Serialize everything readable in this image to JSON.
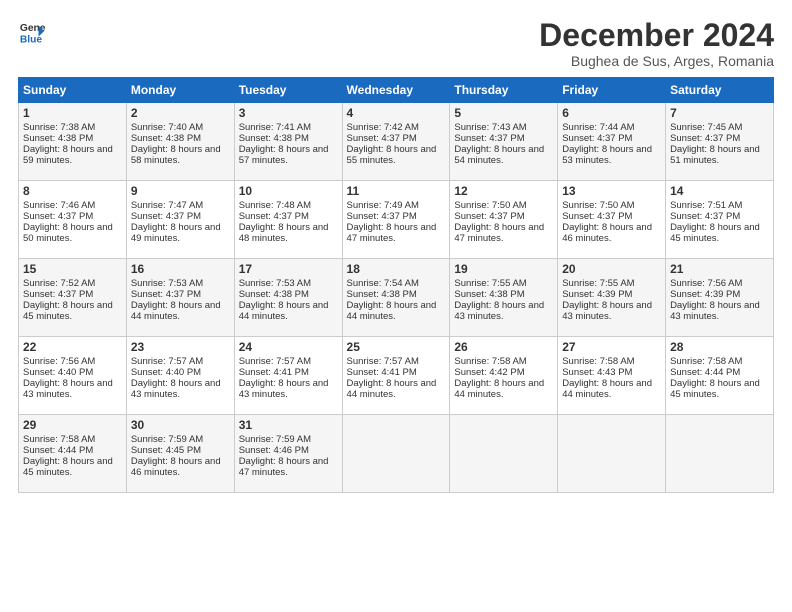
{
  "header": {
    "logo_line1": "General",
    "logo_line2": "Blue",
    "month_title": "December 2024",
    "location": "Bughea de Sus, Arges, Romania"
  },
  "days_of_week": [
    "Sunday",
    "Monday",
    "Tuesday",
    "Wednesday",
    "Thursday",
    "Friday",
    "Saturday"
  ],
  "weeks": [
    [
      {
        "day": "1",
        "sunrise": "Sunrise: 7:38 AM",
        "sunset": "Sunset: 4:38 PM",
        "daylight": "Daylight: 8 hours and 59 minutes."
      },
      {
        "day": "2",
        "sunrise": "Sunrise: 7:40 AM",
        "sunset": "Sunset: 4:38 PM",
        "daylight": "Daylight: 8 hours and 58 minutes."
      },
      {
        "day": "3",
        "sunrise": "Sunrise: 7:41 AM",
        "sunset": "Sunset: 4:38 PM",
        "daylight": "Daylight: 8 hours and 57 minutes."
      },
      {
        "day": "4",
        "sunrise": "Sunrise: 7:42 AM",
        "sunset": "Sunset: 4:37 PM",
        "daylight": "Daylight: 8 hours and 55 minutes."
      },
      {
        "day": "5",
        "sunrise": "Sunrise: 7:43 AM",
        "sunset": "Sunset: 4:37 PM",
        "daylight": "Daylight: 8 hours and 54 minutes."
      },
      {
        "day": "6",
        "sunrise": "Sunrise: 7:44 AM",
        "sunset": "Sunset: 4:37 PM",
        "daylight": "Daylight: 8 hours and 53 minutes."
      },
      {
        "day": "7",
        "sunrise": "Sunrise: 7:45 AM",
        "sunset": "Sunset: 4:37 PM",
        "daylight": "Daylight: 8 hours and 51 minutes."
      }
    ],
    [
      {
        "day": "8",
        "sunrise": "Sunrise: 7:46 AM",
        "sunset": "Sunset: 4:37 PM",
        "daylight": "Daylight: 8 hours and 50 minutes."
      },
      {
        "day": "9",
        "sunrise": "Sunrise: 7:47 AM",
        "sunset": "Sunset: 4:37 PM",
        "daylight": "Daylight: 8 hours and 49 minutes."
      },
      {
        "day": "10",
        "sunrise": "Sunrise: 7:48 AM",
        "sunset": "Sunset: 4:37 PM",
        "daylight": "Daylight: 8 hours and 48 minutes."
      },
      {
        "day": "11",
        "sunrise": "Sunrise: 7:49 AM",
        "sunset": "Sunset: 4:37 PM",
        "daylight": "Daylight: 8 hours and 47 minutes."
      },
      {
        "day": "12",
        "sunrise": "Sunrise: 7:50 AM",
        "sunset": "Sunset: 4:37 PM",
        "daylight": "Daylight: 8 hours and 47 minutes."
      },
      {
        "day": "13",
        "sunrise": "Sunrise: 7:50 AM",
        "sunset": "Sunset: 4:37 PM",
        "daylight": "Daylight: 8 hours and 46 minutes."
      },
      {
        "day": "14",
        "sunrise": "Sunrise: 7:51 AM",
        "sunset": "Sunset: 4:37 PM",
        "daylight": "Daylight: 8 hours and 45 minutes."
      }
    ],
    [
      {
        "day": "15",
        "sunrise": "Sunrise: 7:52 AM",
        "sunset": "Sunset: 4:37 PM",
        "daylight": "Daylight: 8 hours and 45 minutes."
      },
      {
        "day": "16",
        "sunrise": "Sunrise: 7:53 AM",
        "sunset": "Sunset: 4:37 PM",
        "daylight": "Daylight: 8 hours and 44 minutes."
      },
      {
        "day": "17",
        "sunrise": "Sunrise: 7:53 AM",
        "sunset": "Sunset: 4:38 PM",
        "daylight": "Daylight: 8 hours and 44 minutes."
      },
      {
        "day": "18",
        "sunrise": "Sunrise: 7:54 AM",
        "sunset": "Sunset: 4:38 PM",
        "daylight": "Daylight: 8 hours and 44 minutes."
      },
      {
        "day": "19",
        "sunrise": "Sunrise: 7:55 AM",
        "sunset": "Sunset: 4:38 PM",
        "daylight": "Daylight: 8 hours and 43 minutes."
      },
      {
        "day": "20",
        "sunrise": "Sunrise: 7:55 AM",
        "sunset": "Sunset: 4:39 PM",
        "daylight": "Daylight: 8 hours and 43 minutes."
      },
      {
        "day": "21",
        "sunrise": "Sunrise: 7:56 AM",
        "sunset": "Sunset: 4:39 PM",
        "daylight": "Daylight: 8 hours and 43 minutes."
      }
    ],
    [
      {
        "day": "22",
        "sunrise": "Sunrise: 7:56 AM",
        "sunset": "Sunset: 4:40 PM",
        "daylight": "Daylight: 8 hours and 43 minutes."
      },
      {
        "day": "23",
        "sunrise": "Sunrise: 7:57 AM",
        "sunset": "Sunset: 4:40 PM",
        "daylight": "Daylight: 8 hours and 43 minutes."
      },
      {
        "day": "24",
        "sunrise": "Sunrise: 7:57 AM",
        "sunset": "Sunset: 4:41 PM",
        "daylight": "Daylight: 8 hours and 43 minutes."
      },
      {
        "day": "25",
        "sunrise": "Sunrise: 7:57 AM",
        "sunset": "Sunset: 4:41 PM",
        "daylight": "Daylight: 8 hours and 44 minutes."
      },
      {
        "day": "26",
        "sunrise": "Sunrise: 7:58 AM",
        "sunset": "Sunset: 4:42 PM",
        "daylight": "Daylight: 8 hours and 44 minutes."
      },
      {
        "day": "27",
        "sunrise": "Sunrise: 7:58 AM",
        "sunset": "Sunset: 4:43 PM",
        "daylight": "Daylight: 8 hours and 44 minutes."
      },
      {
        "day": "28",
        "sunrise": "Sunrise: 7:58 AM",
        "sunset": "Sunset: 4:44 PM",
        "daylight": "Daylight: 8 hours and 45 minutes."
      }
    ],
    [
      {
        "day": "29",
        "sunrise": "Sunrise: 7:58 AM",
        "sunset": "Sunset: 4:44 PM",
        "daylight": "Daylight: 8 hours and 45 minutes."
      },
      {
        "day": "30",
        "sunrise": "Sunrise: 7:59 AM",
        "sunset": "Sunset: 4:45 PM",
        "daylight": "Daylight: 8 hours and 46 minutes."
      },
      {
        "day": "31",
        "sunrise": "Sunrise: 7:59 AM",
        "sunset": "Sunset: 4:46 PM",
        "daylight": "Daylight: 8 hours and 47 minutes."
      },
      null,
      null,
      null,
      null
    ]
  ]
}
